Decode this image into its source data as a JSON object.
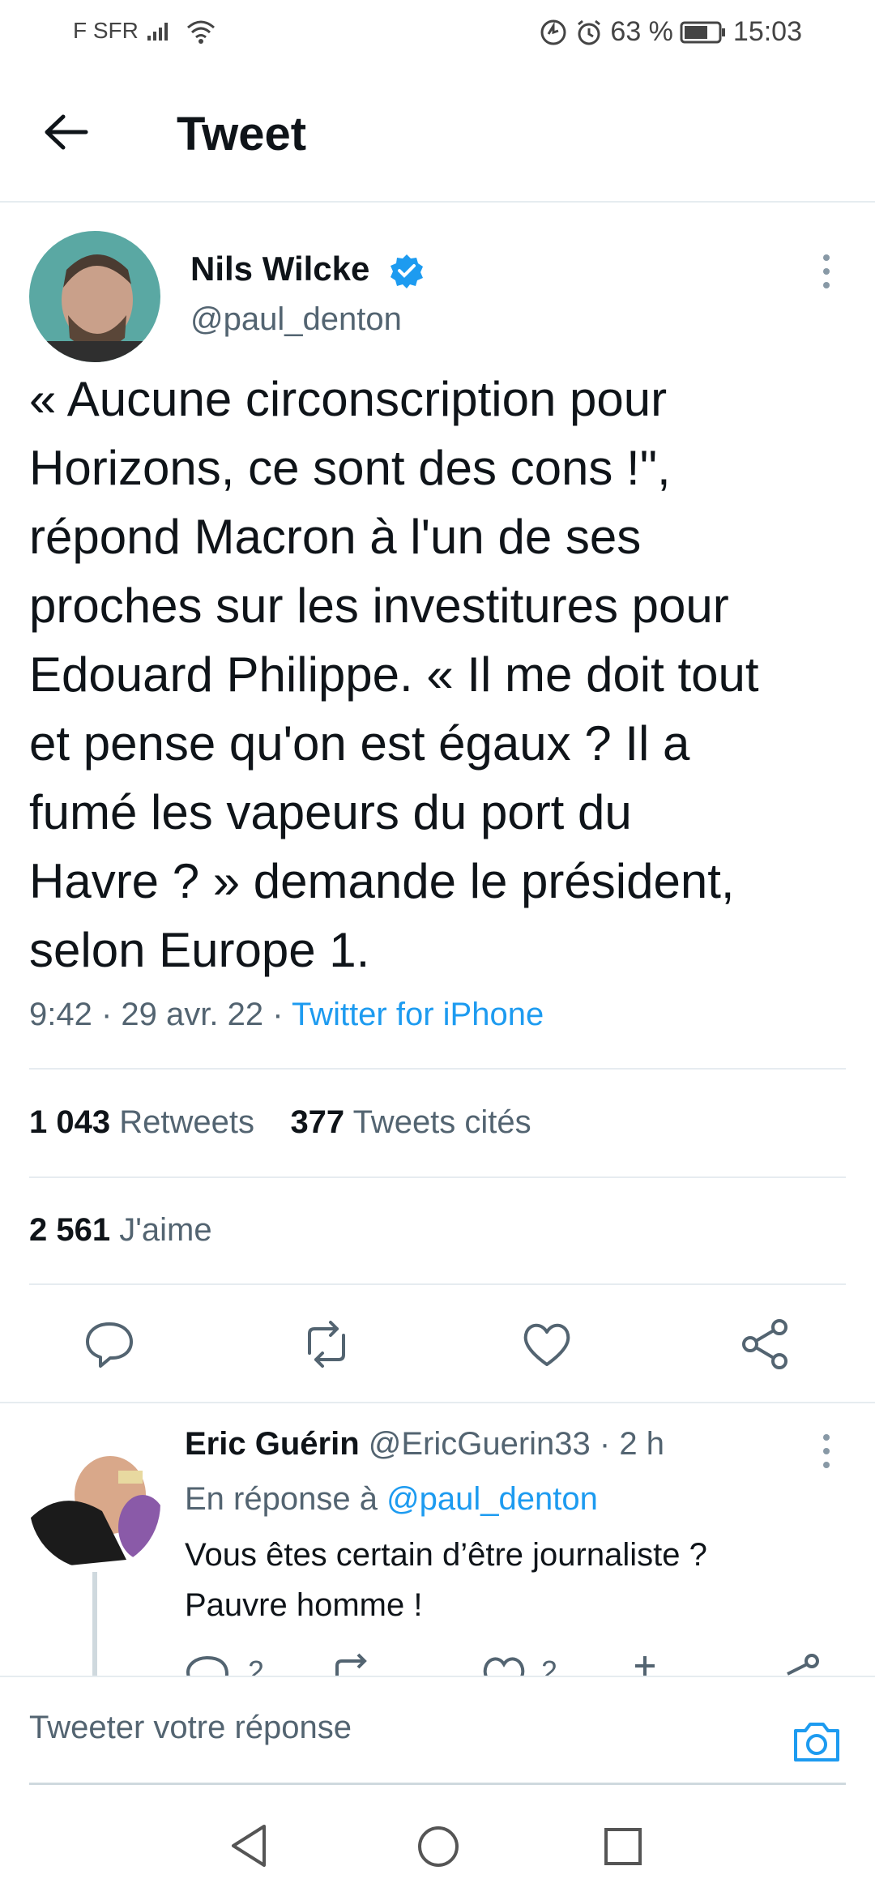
{
  "status_bar": {
    "carrier": "F SFR",
    "battery": "63 %",
    "time": "15:03"
  },
  "header": {
    "title": "Tweet"
  },
  "tweet": {
    "author_name": "Nils Wilcke",
    "author_handle": "@paul_denton",
    "text": "« Aucune circonscription pour\nHorizons, ce sont des cons !\",\nrépond Macron à l'un de ses\nproches sur les investitures pour\nEdouard Philippe. « Il me doit tout\net pense qu'on est égaux ? Il a\nfumé les vapeurs du port du\nHavre ? » demande le président,\nselon Europe 1.",
    "time": "9:42",
    "date": "29 avr. 22",
    "source": "Twitter for iPhone",
    "retweets_count": "1 043",
    "retweets_label": "Retweets",
    "quotes_count": "377",
    "quotes_label": "Tweets cités",
    "likes_count": "2 561",
    "likes_label": "J'aime"
  },
  "reply": {
    "author_name": "Eric Guérin",
    "author_handle": "@EricGuerin33",
    "age": "2 h",
    "in_reply_prefix": "En réponse à",
    "in_reply_handle": "@paul_denton",
    "text": "Vous êtes certain d’être journaliste ?\nPauvre homme !",
    "reply_count": "2",
    "like_count": "2"
  },
  "composer": {
    "placeholder": "Tweeter votre réponse"
  },
  "colors": {
    "accent": "#1d9bf0",
    "secondary_text": "#536471",
    "divider": "#e6ecf0"
  }
}
